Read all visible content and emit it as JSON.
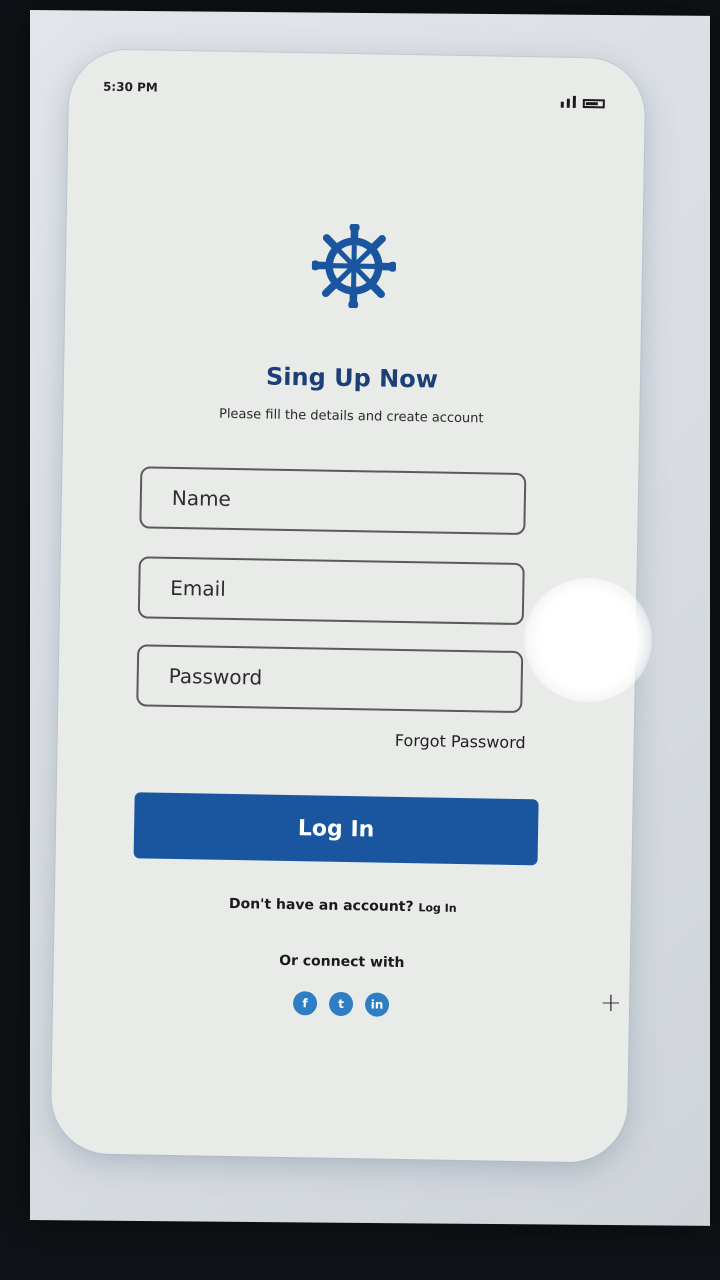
{
  "status_bar": {
    "time": "5:30 PM"
  },
  "brand": {
    "logo_icon": "ship-wheel-icon",
    "accent_color": "#1a56a0",
    "title_color": "#1c3f78"
  },
  "header": {
    "title": "Sing Up Now",
    "subtitle": "Please fill the details and create account"
  },
  "form": {
    "name_placeholder": "Name",
    "email_placeholder": "Email",
    "password_placeholder": "Password",
    "forgot_label": "Forgot Password",
    "submit_label": "Log In"
  },
  "footer": {
    "account_prompt": "Don't have an account?",
    "account_link": "Log In",
    "connect_label": "Or connect with",
    "socials": [
      {
        "icon": "facebook-icon",
        "glyph": "f"
      },
      {
        "icon": "twitter-icon",
        "glyph": "t"
      },
      {
        "icon": "linkedin-icon",
        "glyph": "in"
      }
    ]
  }
}
